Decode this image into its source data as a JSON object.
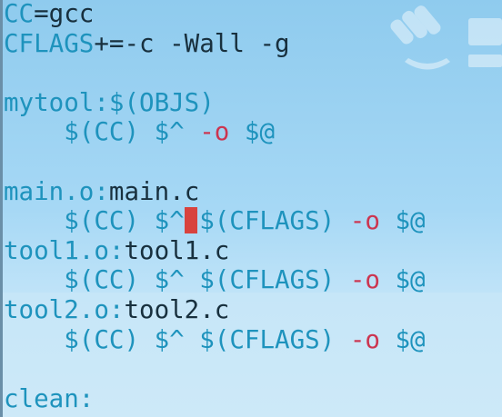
{
  "editor": {
    "lines": [
      [
        {
          "t": "CC",
          "c": "k"
        },
        {
          "t": "=gcc",
          "c": "n"
        }
      ],
      [
        {
          "t": "CFLAGS",
          "c": "k"
        },
        {
          "t": "+=-c -Wall -g",
          "c": "n"
        }
      ],
      [],
      [
        {
          "t": "mytool:$(OBJS)",
          "c": "k"
        }
      ],
      [
        {
          "t": "    $(CC) $^ ",
          "c": "k"
        },
        {
          "t": "-o",
          "c": "r"
        },
        {
          "t": " $@",
          "c": "k"
        }
      ],
      [],
      [
        {
          "t": "main.o:",
          "c": "k"
        },
        {
          "t": "main.c",
          "c": "n"
        }
      ],
      [
        {
          "t": "    $(CC) $^",
          "c": "k"
        },
        {
          "cursor": true
        },
        {
          "t": "$(CFLAGS) ",
          "c": "k"
        },
        {
          "t": "-o",
          "c": "r"
        },
        {
          "t": " $@",
          "c": "k"
        }
      ],
      [
        {
          "t": "tool1.o:",
          "c": "k"
        },
        {
          "t": "tool1.c",
          "c": "n"
        }
      ],
      [
        {
          "t": "    $(CC) $^ $(CFLAGS) ",
          "c": "k"
        },
        {
          "t": "-o",
          "c": "r"
        },
        {
          "t": " $@",
          "c": "k"
        }
      ],
      [
        {
          "t": "tool2.o:",
          "c": "k"
        },
        {
          "t": "tool2.c",
          "c": "n"
        }
      ],
      [
        {
          "t": "    $(CC) $^ $(CFLAGS) ",
          "c": "k"
        },
        {
          "t": "-o",
          "c": "r"
        },
        {
          "t": " $@",
          "c": "k"
        }
      ],
      [],
      [
        {
          "t": "clean:",
          "c": "k"
        }
      ]
    ]
  },
  "colors": {
    "keyword": "#1e93bd",
    "text": "#18303e",
    "option": "#cc3550",
    "cursor": "#d8433e"
  },
  "watermark_icon": "fist-logo-icon"
}
